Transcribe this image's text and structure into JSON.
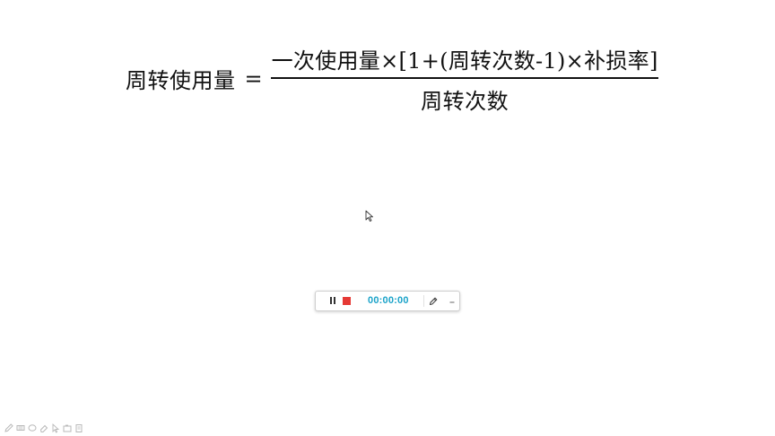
{
  "formula": {
    "lhs": "周转使用量",
    "equals": "=",
    "numerator": "一次使用量×[1+(周转次数-1)×补损率]",
    "denominator": "周转次数"
  },
  "recorder": {
    "timer": "00:00:00",
    "colors": {
      "stop": "#e53935",
      "timer": "#1ba3c9"
    },
    "icons": [
      "pause-icon",
      "stop-icon",
      "pen-icon",
      "minimize-icon"
    ]
  },
  "tools": {
    "icons": [
      "pen-icon",
      "highlighter-icon",
      "shape-icon",
      "eraser-icon",
      "pointer-icon",
      "camera-icon",
      "clipboard-icon"
    ]
  }
}
